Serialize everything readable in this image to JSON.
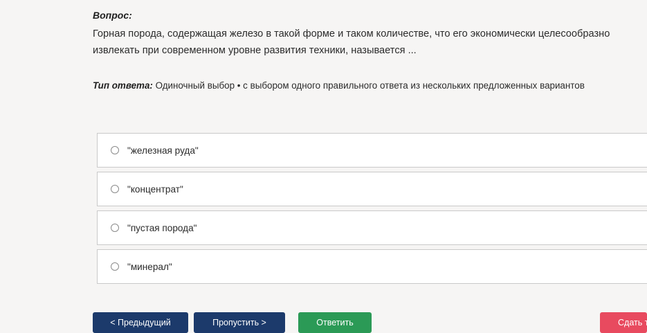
{
  "question": {
    "heading": "Вопрос:",
    "text": "Горная порода, содержащая железо в такой форме и таком количестве, что его экономически целесообразно извлекать при современном уровне развития техники, называется ..."
  },
  "answer_type": {
    "label": "Тип ответа:",
    "value": " Одиночный выбор • с выбором одного правильного ответа из нескольких предложенных вариантов"
  },
  "options": [
    {
      "label": "\"железная руда\""
    },
    {
      "label": "\"концентрат\""
    },
    {
      "label": "\"пустая порода\""
    },
    {
      "label": "\"минерал\""
    }
  ],
  "buttons": {
    "prev": "< Предыдущий",
    "skip": "Пропустить >",
    "answer": "Ответить",
    "submit": "Сдать т"
  },
  "colors": {
    "background": "#f6f5f4",
    "nav_button": "#1c3a6b",
    "answer_button": "#2b9a56",
    "submit_button": "#e84a5f"
  }
}
